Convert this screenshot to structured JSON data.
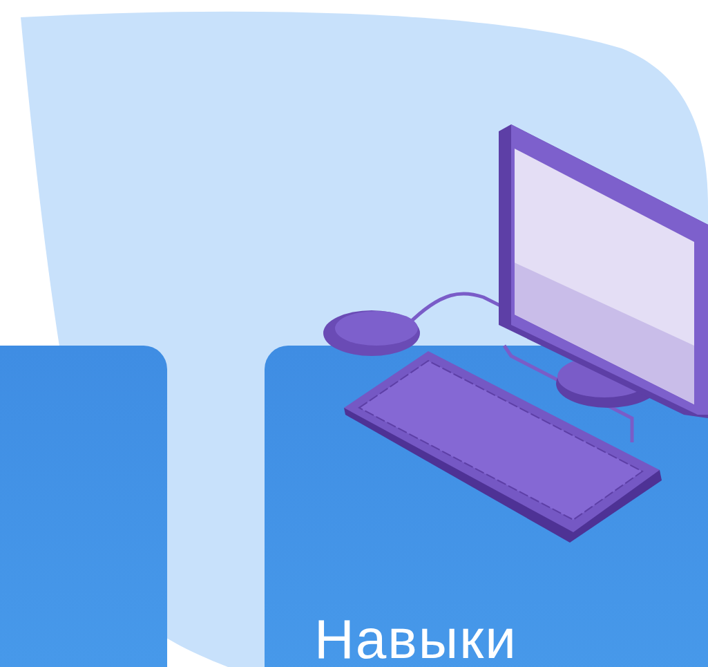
{
  "cards": [
    {
      "kind": "blank"
    },
    {
      "kind": "titled",
      "title": "Навыки"
    }
  ]
}
